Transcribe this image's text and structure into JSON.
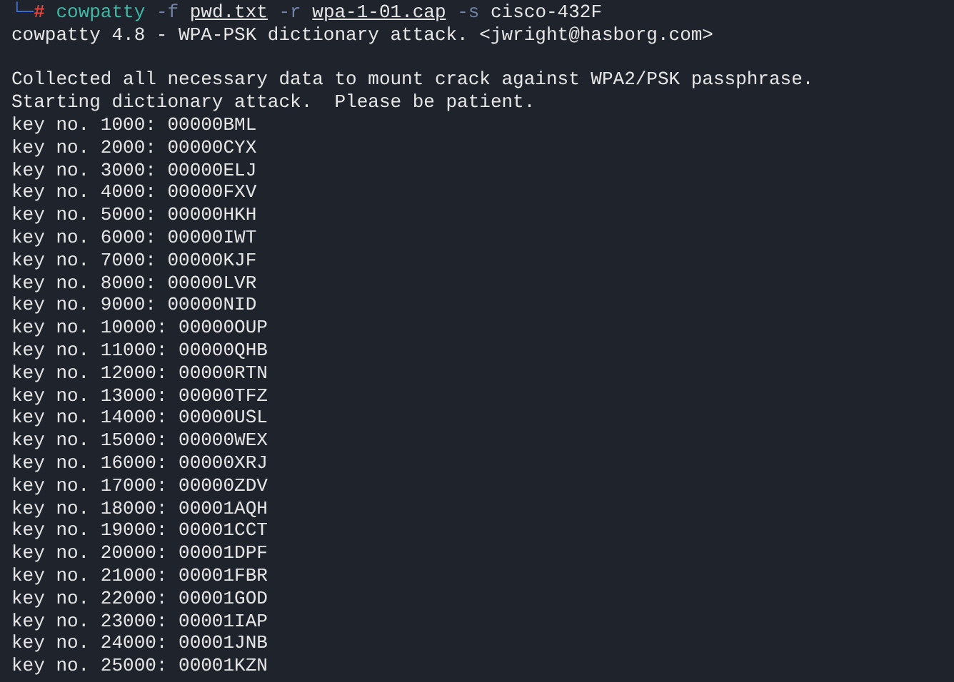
{
  "prompt": {
    "corner": "└─",
    "symbol": "#",
    "tokens": [
      {
        "text": "cowpatty",
        "kind": "command"
      },
      {
        "text": "-f",
        "kind": "option"
      },
      {
        "text": "pwd.txt",
        "kind": "path"
      },
      {
        "text": "-r",
        "kind": "option"
      },
      {
        "text": "wpa-1-01.cap",
        "kind": "path"
      },
      {
        "text": "-s",
        "kind": "option"
      },
      {
        "text": "cisco-432F",
        "kind": "plain"
      }
    ]
  },
  "banner": "cowpatty 4.8 - WPA-PSK dictionary attack. <jwright@hasborg.com>",
  "messages": [
    "Collected all necessary data to mount crack against WPA2/PSK passphrase.",
    "Starting dictionary attack.  Please be patient."
  ],
  "key_lines": [
    "key no. 1000: 00000BML",
    "key no. 2000: 00000CYX",
    "key no. 3000: 00000ELJ",
    "key no. 4000: 00000FXV",
    "key no. 5000: 00000HKH",
    "key no. 6000: 00000IWT",
    "key no. 7000: 00000KJF",
    "key no. 8000: 00000LVR",
    "key no. 9000: 00000NID",
    "key no. 10000: 00000OUP",
    "key no. 11000: 00000QHB",
    "key no. 12000: 00000RTN",
    "key no. 13000: 00000TFZ",
    "key no. 14000: 00000USL",
    "key no. 15000: 00000WEX",
    "key no. 16000: 00000XRJ",
    "key no. 17000: 00000ZDV",
    "key no. 18000: 00001AQH",
    "key no. 19000: 00001CCT",
    "key no. 20000: 00001DPF",
    "key no. 21000: 00001FBR",
    "key no. 22000: 00001GOD",
    "key no. 23000: 00001IAP",
    "key no. 24000: 00001JNB",
    "key no. 25000: 00001KZN"
  ]
}
